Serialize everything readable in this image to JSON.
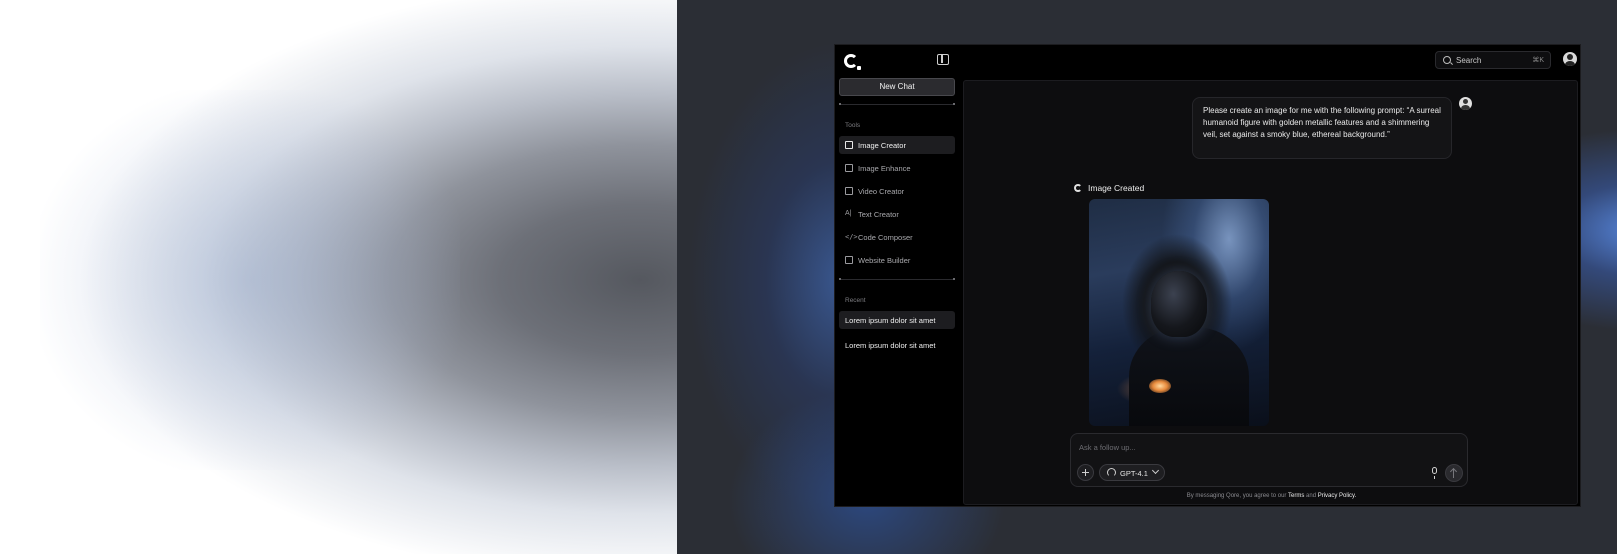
{
  "header": {
    "search_label": "Search",
    "search_shortcut": "⌘K"
  },
  "sidebar": {
    "new_chat_label": "New Chat",
    "tools_heading": "Tools",
    "tools": [
      {
        "label": "Image Creator",
        "icon": "image-icon"
      },
      {
        "label": "Image Enhance",
        "icon": "image-enhance-icon"
      },
      {
        "label": "Video Creator",
        "icon": "video-icon"
      },
      {
        "label": "Text Creator",
        "icon": "text-icon"
      },
      {
        "label": "Code Composer",
        "icon": "code-icon"
      },
      {
        "label": "Website Builder",
        "icon": "website-icon"
      }
    ],
    "recent_heading": "Recent",
    "recent": [
      {
        "label": "Lorem ipsum dolor sit amet"
      },
      {
        "label": "Lorem ipsum dolor sit amet"
      }
    ]
  },
  "chat": {
    "user_message": "Please create an image for me with the following prompt: “A surreal humanoid figure with golden metallic features and a shimmering veil, set against a smoky blue, ethereal background.”",
    "bot_status": "Image Created"
  },
  "composer": {
    "placeholder": "Ask a follow up...",
    "model_label": "GPT-4.1"
  },
  "footer": {
    "disclaimer_prefix": "By messaging Qore, you agree to our",
    "terms_label": "Terms",
    "and_label": "and",
    "privacy_label": "Privacy Policy."
  },
  "colors": {
    "app_background": "#000000",
    "page_background": "#2b2e35",
    "accent_blue": "#5a8ce6"
  }
}
